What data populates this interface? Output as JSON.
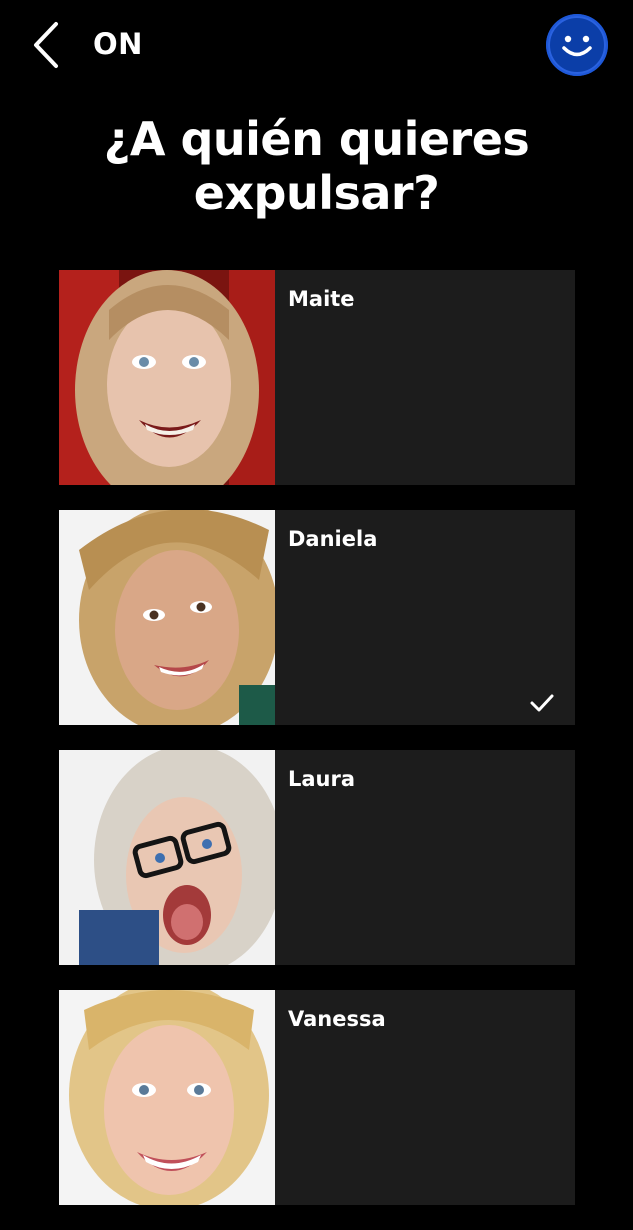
{
  "header": {
    "brand": "ON",
    "accent": "#0b3ea8"
  },
  "title": "¿A quién quieres expulsar?",
  "candidates": [
    {
      "name": "Maite",
      "selected": false,
      "bg": "#b4211c",
      "hair": "#c9a77e",
      "skin": "#e7c3ad"
    },
    {
      "name": "Daniela",
      "selected": true,
      "bg": "#f3f3f3",
      "hair": "#c8a36a",
      "skin": "#d9a787"
    },
    {
      "name": "Laura",
      "selected": false,
      "bg": "#f2f2f2",
      "hair": "#d8d2c8",
      "skin": "#e9c7b3"
    },
    {
      "name": "Vanessa",
      "selected": false,
      "bg": "#f4f4f4",
      "hair": "#e2c588",
      "skin": "#efc4ad"
    }
  ]
}
